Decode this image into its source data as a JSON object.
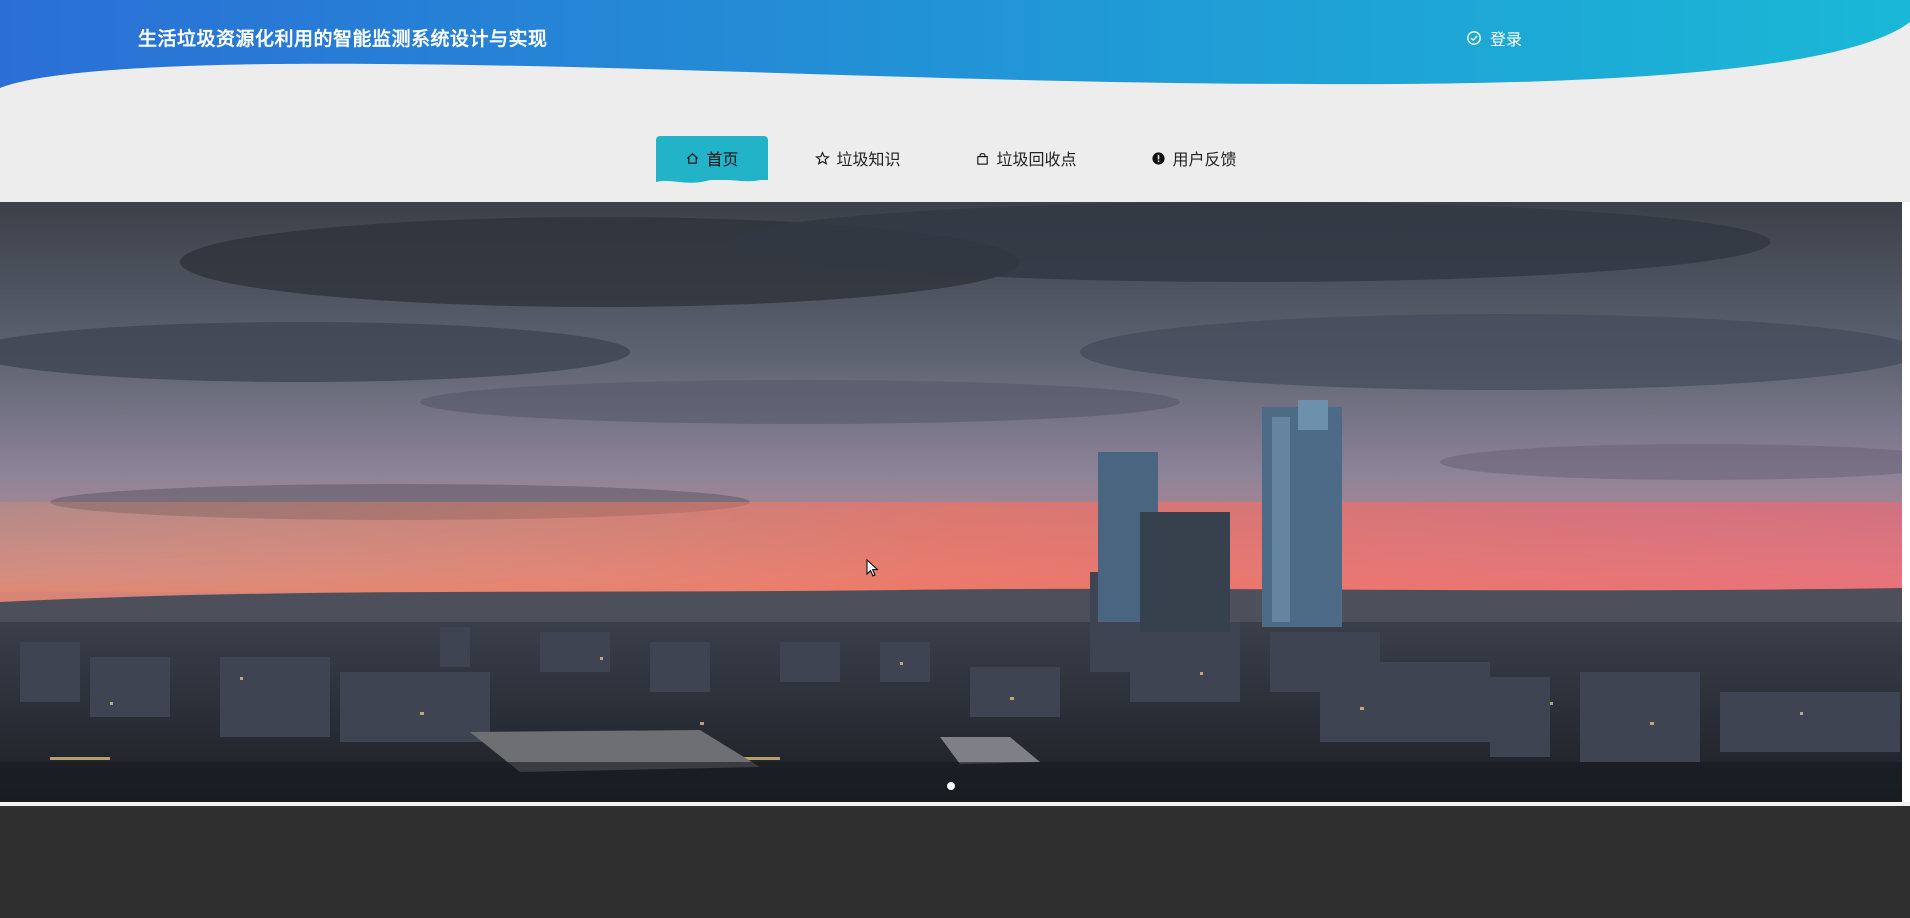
{
  "header": {
    "title": "生活垃圾资源化利用的智能监测系统设计与实现",
    "login_label": "登录",
    "login_icon": "check-circle-icon",
    "gradient_start": "#2a6fd6",
    "gradient_end": "#1ab8d6"
  },
  "nav": {
    "items": [
      {
        "label": "首页",
        "icon": "home-icon",
        "active": true
      },
      {
        "label": "垃圾知识",
        "icon": "star-icon",
        "active": false
      },
      {
        "label": "垃圾回收点",
        "icon": "bag-icon",
        "active": false
      },
      {
        "label": "用户反馈",
        "icon": "alert-circle-icon",
        "active": false
      }
    ],
    "active_color": "#22b3c9"
  },
  "banner": {
    "image_icon": "city-skyline-image",
    "slides": 1,
    "active_slide": 1
  },
  "footer": {
    "color": "#2f2f2f"
  }
}
